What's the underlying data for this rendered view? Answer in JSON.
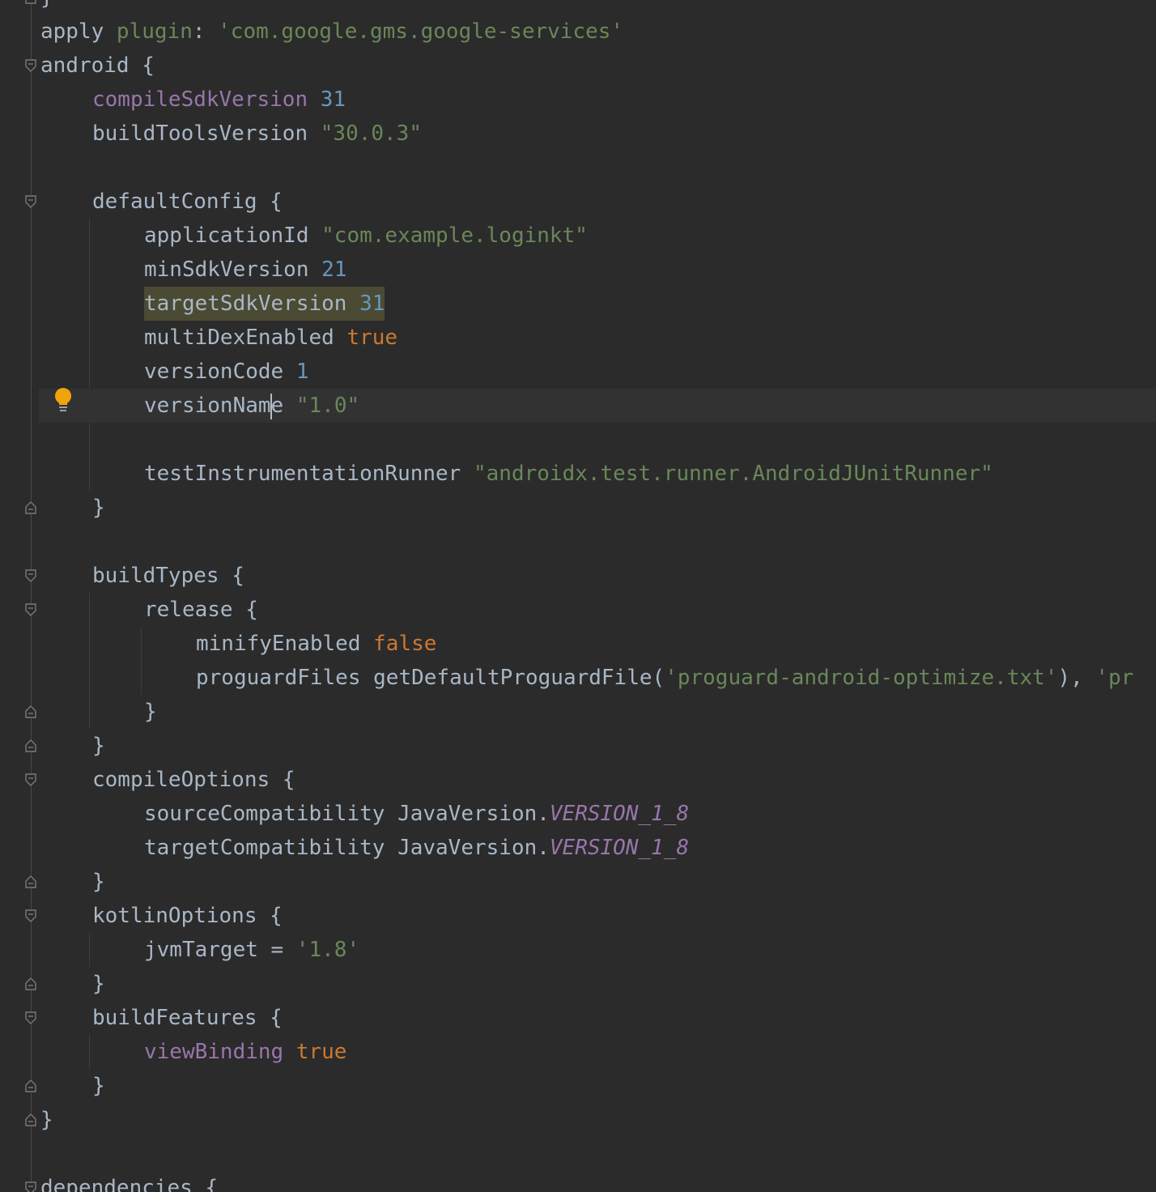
{
  "editor": {
    "language": "gradle",
    "colors": {
      "background": "#2b2b2b",
      "keyword": "#cc7832",
      "string": "#6a8759",
      "number": "#6897bb",
      "property": "#9876aa",
      "text": "#a9b7c6"
    },
    "lines": [
      {
        "indent": 0,
        "tokens": [
          {
            "t": "}",
            "c": "plain"
          }
        ]
      },
      {
        "indent": 0,
        "tokens": [
          {
            "t": "apply ",
            "c": "plain"
          },
          {
            "t": "plugin",
            "c": "str"
          },
          {
            "t": ": ",
            "c": "plain"
          },
          {
            "t": "'com.google.gms.google-services'",
            "c": "str"
          }
        ]
      },
      {
        "indent": 0,
        "tokens": [
          {
            "t": "android ",
            "c": "plain"
          },
          {
            "t": "{",
            "c": "plain"
          }
        ]
      },
      {
        "indent": 1,
        "tokens": [
          {
            "t": "compileSdkVersion",
            "c": "prop"
          },
          {
            "t": " ",
            "c": "plain"
          },
          {
            "t": "31",
            "c": "num"
          }
        ]
      },
      {
        "indent": 1,
        "tokens": [
          {
            "t": "buildToolsVersion ",
            "c": "plain"
          },
          {
            "t": "\"30.0.3\"",
            "c": "str"
          }
        ]
      },
      {
        "indent": 0,
        "tokens": []
      },
      {
        "indent": 1,
        "tokens": [
          {
            "t": "defaultConfig ",
            "c": "plain"
          },
          {
            "t": "{",
            "c": "plain"
          }
        ]
      },
      {
        "indent": 2,
        "tokens": [
          {
            "t": "applicationId ",
            "c": "plain"
          },
          {
            "t": "\"com.example.loginkt\"",
            "c": "str"
          }
        ]
      },
      {
        "indent": 2,
        "tokens": [
          {
            "t": "minSdkVersion ",
            "c": "plain"
          },
          {
            "t": "21",
            "c": "num"
          }
        ]
      },
      {
        "indent": 2,
        "highlight": true,
        "tokens": [
          {
            "t": "targetSdkVersion ",
            "c": "plain"
          },
          {
            "t": "31",
            "c": "num"
          }
        ]
      },
      {
        "indent": 2,
        "tokens": [
          {
            "t": "multiDexEnabled ",
            "c": "plain"
          },
          {
            "t": "true",
            "c": "kw"
          }
        ]
      },
      {
        "indent": 2,
        "tokens": [
          {
            "t": "versionCode ",
            "c": "plain"
          },
          {
            "t": "1",
            "c": "num"
          }
        ]
      },
      {
        "indent": 2,
        "current": true,
        "caret_after": 10,
        "tokens": [
          {
            "t": "versionName ",
            "c": "plain"
          },
          {
            "t": "\"1.0\"",
            "c": "str"
          }
        ]
      },
      {
        "indent": 0,
        "tokens": []
      },
      {
        "indent": 2,
        "tokens": [
          {
            "t": "testInstrumentationRunner ",
            "c": "plain"
          },
          {
            "t": "\"androidx.test.runner.AndroidJUnitRunner\"",
            "c": "str"
          }
        ]
      },
      {
        "indent": 1,
        "tokens": [
          {
            "t": "}",
            "c": "plain"
          }
        ]
      },
      {
        "indent": 0,
        "tokens": []
      },
      {
        "indent": 1,
        "tokens": [
          {
            "t": "buildTypes ",
            "c": "plain"
          },
          {
            "t": "{",
            "c": "plain"
          }
        ]
      },
      {
        "indent": 2,
        "tokens": [
          {
            "t": "release ",
            "c": "plain"
          },
          {
            "t": "{",
            "c": "plain"
          }
        ]
      },
      {
        "indent": 3,
        "tokens": [
          {
            "t": "minifyEnabled ",
            "c": "plain"
          },
          {
            "t": "false",
            "c": "kw"
          }
        ]
      },
      {
        "indent": 3,
        "tokens": [
          {
            "t": "proguardFiles getDefaultProguardFile(",
            "c": "plain"
          },
          {
            "t": "'proguard-android-optimize.txt'",
            "c": "str"
          },
          {
            "t": "), ",
            "c": "plain"
          },
          {
            "t": "'pr",
            "c": "str"
          }
        ]
      },
      {
        "indent": 2,
        "tokens": [
          {
            "t": "}",
            "c": "plain"
          }
        ]
      },
      {
        "indent": 1,
        "tokens": [
          {
            "t": "}",
            "c": "plain"
          }
        ]
      },
      {
        "indent": 1,
        "tokens": [
          {
            "t": "compileOptions ",
            "c": "plain"
          },
          {
            "t": "{",
            "c": "plain"
          }
        ]
      },
      {
        "indent": 2,
        "tokens": [
          {
            "t": "sourceCompatibility JavaVersion.",
            "c": "plain"
          },
          {
            "t": "VERSION_1_8",
            "c": "const"
          }
        ]
      },
      {
        "indent": 2,
        "tokens": [
          {
            "t": "targetCompatibility JavaVersion.",
            "c": "plain"
          },
          {
            "t": "VERSION_1_8",
            "c": "const"
          }
        ]
      },
      {
        "indent": 1,
        "tokens": [
          {
            "t": "}",
            "c": "plain"
          }
        ]
      },
      {
        "indent": 1,
        "tokens": [
          {
            "t": "kotlinOptions ",
            "c": "plain"
          },
          {
            "t": "{",
            "c": "plain"
          }
        ]
      },
      {
        "indent": 2,
        "tokens": [
          {
            "t": "jvmTarget = ",
            "c": "plain"
          },
          {
            "t": "'1.8'",
            "c": "str"
          }
        ]
      },
      {
        "indent": 1,
        "tokens": [
          {
            "t": "}",
            "c": "plain"
          }
        ]
      },
      {
        "indent": 1,
        "tokens": [
          {
            "t": "buildFeatures ",
            "c": "plain"
          },
          {
            "t": "{",
            "c": "plain"
          }
        ]
      },
      {
        "indent": 2,
        "tokens": [
          {
            "t": "viewBinding",
            "c": "prop"
          },
          {
            "t": " ",
            "c": "plain"
          },
          {
            "t": "true",
            "c": "kw"
          }
        ]
      },
      {
        "indent": 1,
        "tokens": [
          {
            "t": "}",
            "c": "plain"
          }
        ]
      },
      {
        "indent": 0,
        "tokens": [
          {
            "t": "}",
            "c": "plain"
          }
        ]
      },
      {
        "indent": 0,
        "tokens": []
      },
      {
        "indent": 0,
        "tokens": [
          {
            "t": "dependencies ",
            "c": "plain"
          },
          {
            "t": "{",
            "c": "plain"
          }
        ]
      }
    ],
    "folds": [
      {
        "line": 0,
        "kind": "end"
      },
      {
        "line": 2,
        "kind": "start"
      },
      {
        "line": 6,
        "kind": "start"
      },
      {
        "line": 15,
        "kind": "end"
      },
      {
        "line": 17,
        "kind": "start"
      },
      {
        "line": 18,
        "kind": "start"
      },
      {
        "line": 21,
        "kind": "end"
      },
      {
        "line": 22,
        "kind": "end"
      },
      {
        "line": 23,
        "kind": "start"
      },
      {
        "line": 26,
        "kind": "end"
      },
      {
        "line": 27,
        "kind": "start"
      },
      {
        "line": 29,
        "kind": "end"
      },
      {
        "line": 30,
        "kind": "start"
      },
      {
        "line": 32,
        "kind": "end"
      },
      {
        "line": 33,
        "kind": "end"
      },
      {
        "line": 35,
        "kind": "start"
      }
    ],
    "intention_bulb": {
      "icon": "lightbulb-icon",
      "color": "#f0a30a",
      "line": 12
    }
  }
}
